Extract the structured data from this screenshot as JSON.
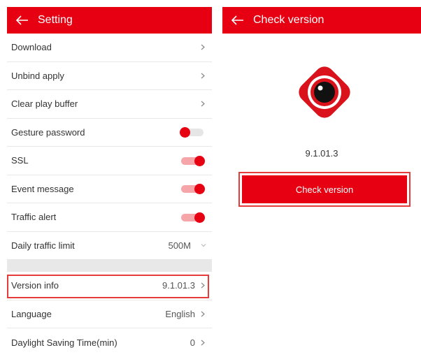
{
  "setting_screen": {
    "title": "Setting",
    "rows": {
      "download": "Download",
      "unbind_apply": "Unbind apply",
      "clear_play_buffer": "Clear play buffer",
      "gesture_password": "Gesture password",
      "ssl": "SSL",
      "event_message": "Event message",
      "traffic_alert": "Traffic alert",
      "daily_traffic_limit": "Daily traffic limit",
      "daily_traffic_limit_value": "500M",
      "version_info": "Version info",
      "version_info_value": "9.1.01.3",
      "language": "Language",
      "language_value": "English",
      "daylight_saving": "Daylight Saving Time(min)",
      "daylight_saving_value": "0"
    },
    "toggles": {
      "gesture_password": false,
      "ssl": true,
      "event_message": true,
      "traffic_alert": true
    }
  },
  "check_version_screen": {
    "title": "Check version",
    "version": "9.1.01.3",
    "button_label": "Check version"
  },
  "colors": {
    "accent": "#e60012",
    "highlight_border": "#e53b3b"
  },
  "icons": [
    "back-arrow-icon",
    "chevron-right-icon",
    "chevron-down-icon",
    "app-logo-icon"
  ]
}
